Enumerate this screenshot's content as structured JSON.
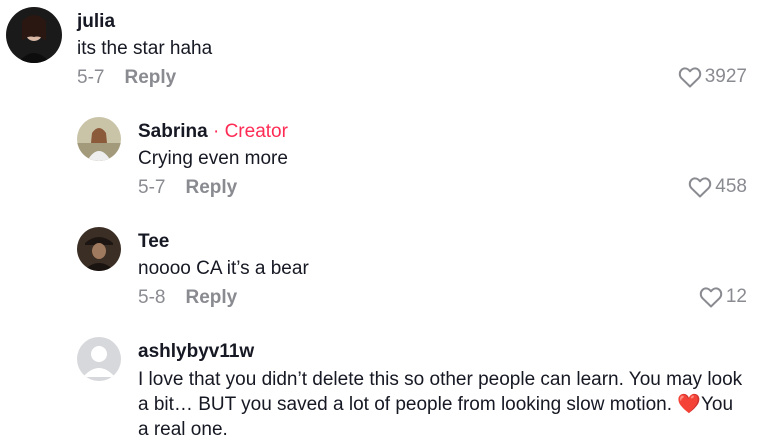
{
  "comments": [
    {
      "username": "julia",
      "text": "its the star haha",
      "date": "5-7",
      "reply_label": "Reply",
      "likes": "3927"
    },
    {
      "username": "Sabrina",
      "badge": " · Creator",
      "text": "Crying even more",
      "date": "5-7",
      "reply_label": "Reply",
      "likes": "458"
    },
    {
      "username": "Tee",
      "text": "noooo CA it’s a bear",
      "date": "5-8",
      "reply_label": "Reply",
      "likes": "12"
    },
    {
      "username": "ashlybyv11w",
      "text_before_emoji": "I love that you didn’t delete this so other people can learn. You may look a bit… BUT you saved a lot of people from looking slow motion. ",
      "emoji": "❤️",
      "text_after_emoji": "You a real one."
    }
  ],
  "colors": {
    "creator_badge": "#fe2c55",
    "meta_text": "#8a8b91",
    "username": "#161823"
  },
  "icons": {
    "like": "heart-outline-icon",
    "default_avatar": "default-avatar-icon"
  }
}
